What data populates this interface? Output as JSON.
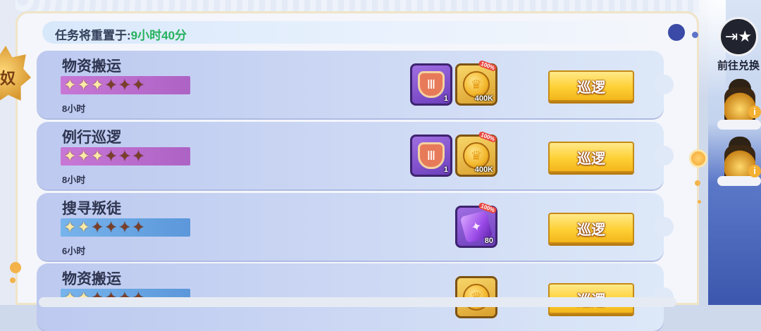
{
  "header": {
    "reset_prefix": "任务将重置于:",
    "reset_time": "9小时40分"
  },
  "rank_badge": {
    "text": "奴"
  },
  "side": {
    "exchange_label": "前往兑换",
    "exchange_icon": "ticket-star-icon",
    "lantern_icon": "lantern-icon",
    "info_icon": "info-icon"
  },
  "missions": [
    {
      "title": "物资搬运",
      "stars_on": 3,
      "stars_total": 6,
      "star_bg": "purple",
      "duration": "8小时",
      "rewards": [
        {
          "icon": "pillar-shield-icon",
          "qty": "1",
          "frame": "purple"
        },
        {
          "icon": "gold-coin-icon",
          "qty": "400K",
          "frame": "gold",
          "badge": "100%"
        }
      ],
      "button": "巡逻"
    },
    {
      "title": "例行巡逻",
      "stars_on": 3,
      "stars_total": 6,
      "star_bg": "purple",
      "duration": "8小时",
      "rewards": [
        {
          "icon": "pillar-shield-icon",
          "qty": "1",
          "frame": "purple"
        },
        {
          "icon": "gold-coin-icon",
          "qty": "400K",
          "frame": "gold",
          "badge": "100%"
        }
      ],
      "button": "巡逻"
    },
    {
      "title": "搜寻叛徒",
      "stars_on": 2,
      "stars_total": 6,
      "star_bg": "blue",
      "duration": "6小时",
      "rewards": [
        {
          "icon": "purple-gem-scroll-icon",
          "qty": "80",
          "frame": "purple",
          "badge": "100%"
        }
      ],
      "button": "巡逻"
    },
    {
      "title": "物资搬运",
      "stars_on": 2,
      "stars_total": 6,
      "star_bg": "blue",
      "duration": "",
      "rewards": [
        {
          "icon": "gold-coin-icon",
          "qty": "",
          "frame": "gold"
        }
      ],
      "button": "巡逻"
    }
  ]
}
